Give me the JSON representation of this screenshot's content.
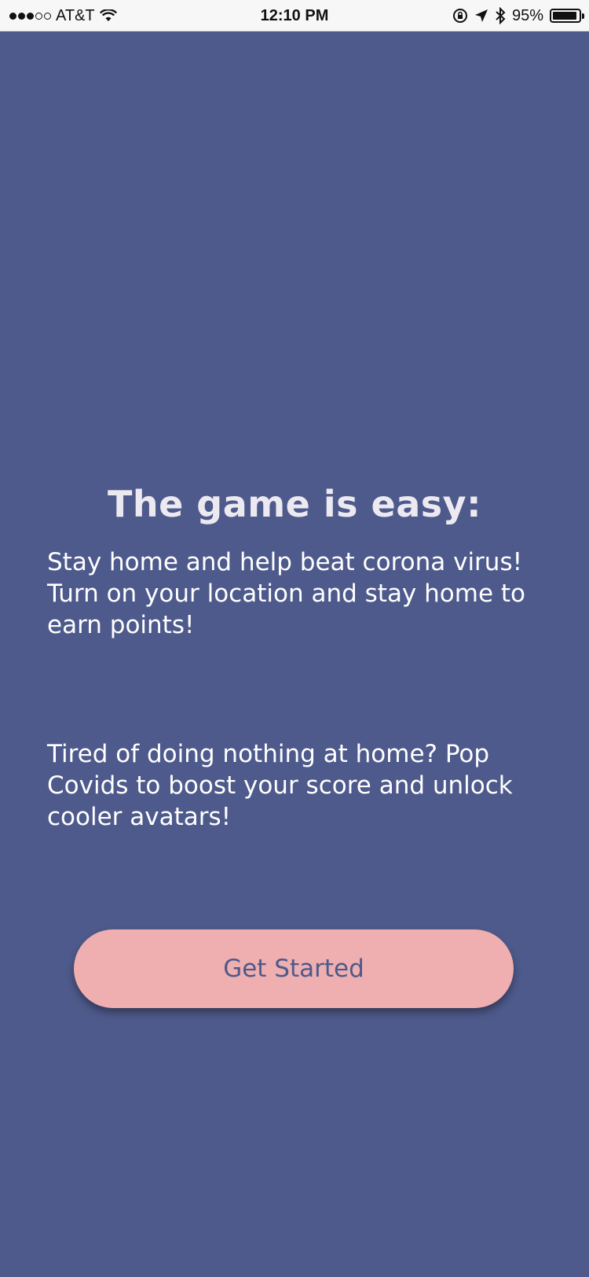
{
  "status_bar": {
    "carrier": "AT&T",
    "time": "12:10 PM",
    "battery_percent": "95%",
    "battery_level": 0.95,
    "icons": [
      "signal-icon",
      "wifi-icon",
      "orientation-lock-icon",
      "location-icon",
      "bluetooth-icon",
      "battery-icon"
    ]
  },
  "onboarding": {
    "title": "The game is easy:",
    "paragraph_1": "Stay home and help beat corona virus!  Turn on your location and stay home to earn points!",
    "paragraph_2": "Tired of doing nothing at home?  Pop Covids to boost your score and unlock cooler avatars!",
    "button_label": "Get Started"
  },
  "colors": {
    "background": "#4e5a8b",
    "button": "#efaeb0",
    "button_text": "#4e5a8b",
    "text": "#ffffff"
  }
}
